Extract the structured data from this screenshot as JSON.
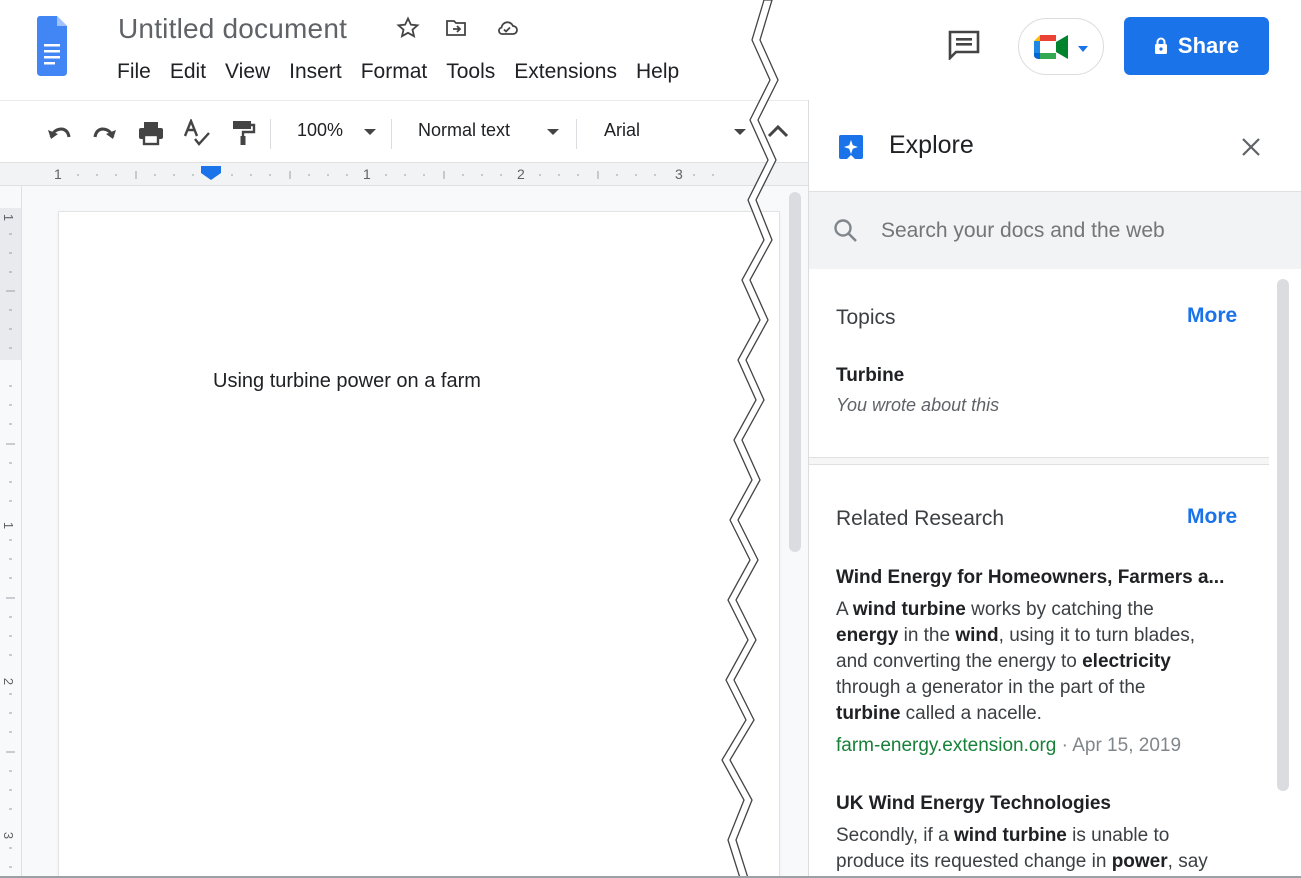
{
  "header": {
    "title": "Untitled document",
    "menu": [
      "File",
      "Edit",
      "View",
      "Insert",
      "Format",
      "Tools",
      "Extensions",
      "Help"
    ],
    "share_label": "Share",
    "icons": [
      "docs-logo-icon",
      "star-icon",
      "move-to-folder-icon",
      "cloud-saved-icon",
      "comments-icon",
      "meet-icon",
      "lock-icon"
    ]
  },
  "toolbar": {
    "zoom": "100%",
    "style": "Normal text",
    "font": "Arial",
    "icons": [
      "undo-icon",
      "redo-icon",
      "print-icon",
      "spellcheck-icon",
      "paint-format-icon",
      "collapse-toolbar-icon"
    ]
  },
  "ruler": {
    "h_labels": [
      "1",
      "1",
      "2",
      "3"
    ],
    "v_labels": [
      "1",
      "1",
      "2",
      "3"
    ]
  },
  "document": {
    "body_text": "Using turbine power on a farm"
  },
  "explore": {
    "title": "Explore",
    "search_placeholder": "Search your docs and the web",
    "topics": {
      "heading": "Topics",
      "more": "More",
      "items": [
        {
          "name": "Turbine",
          "subtitle": "You wrote about this"
        }
      ]
    },
    "research": {
      "heading": "Related Research",
      "more": "More",
      "items": [
        {
          "title": "Wind Energy for Homeowners, Farmers a...",
          "snippet_lines": [
            [
              [
                "A ",
                false
              ],
              [
                "wind turbine",
                true
              ],
              [
                " works by catching the",
                false
              ]
            ],
            [
              [
                "energy",
                true
              ],
              [
                " in the ",
                false
              ],
              [
                "wind",
                true
              ],
              [
                ", using it to turn blades,",
                false
              ]
            ],
            [
              [
                "and converting the energy to ",
                false
              ],
              [
                "electricity",
                true
              ]
            ],
            [
              [
                "through a generator in the part of the",
                false
              ]
            ],
            [
              [
                "turbine",
                true
              ],
              [
                " called a nacelle.",
                false
              ]
            ]
          ],
          "source": "farm-energy.extension.org",
          "date": " · Apr 15, 2019"
        },
        {
          "title": "UK Wind Energy Technologies",
          "snippet_lines": [
            [
              [
                "Secondly, if a ",
                false
              ],
              [
                "wind turbine",
                true
              ],
              [
                " is unable to",
                false
              ]
            ],
            [
              [
                "produce its requested change in ",
                false
              ],
              [
                "power",
                true
              ],
              [
                ", say",
                false
              ]
            ]
          ]
        }
      ]
    }
  },
  "colors": {
    "accent_blue": "#1a73e8",
    "source_green": "#188038",
    "docs_blue": "#4285f4"
  }
}
